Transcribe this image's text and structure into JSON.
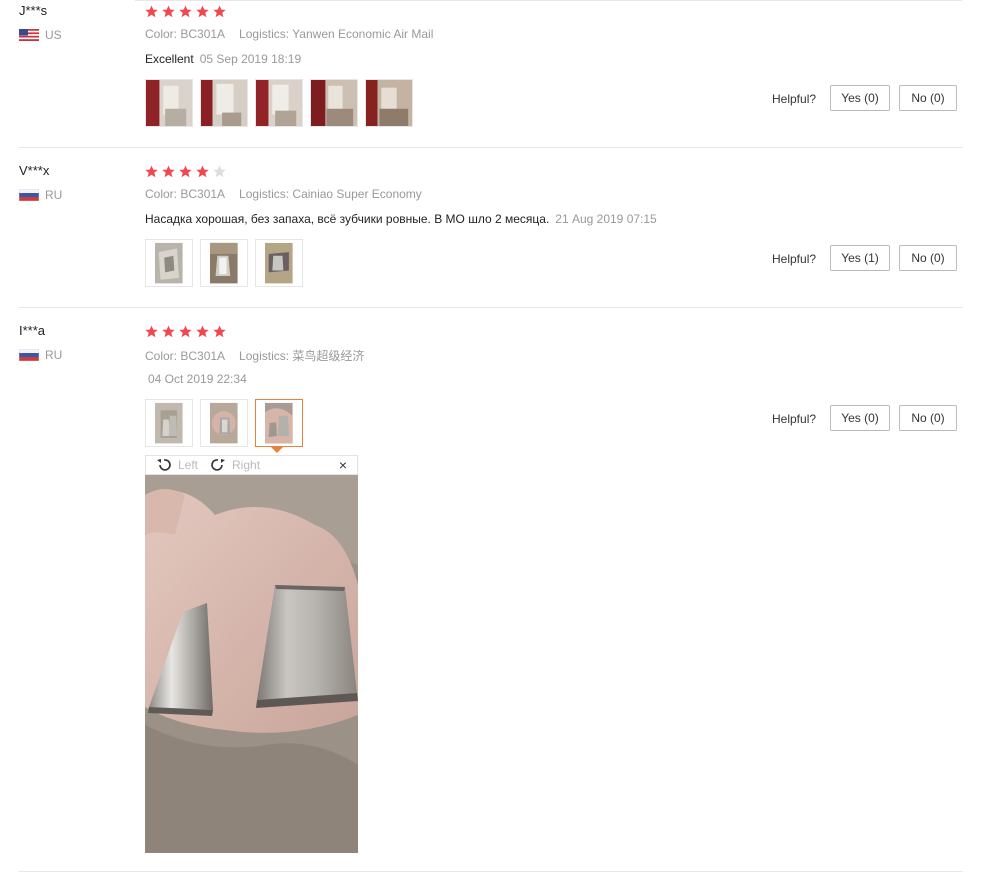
{
  "reviews": [
    {
      "user": "J***s",
      "country": "US",
      "flag": "us-flag",
      "rating": 5,
      "color_label": "Color: BC301A",
      "logistics_label": "Logistics: Yanwen Economic Air Mail",
      "text": "Excellent",
      "date": "05 Sep 2019 18:19",
      "photo_count": 5,
      "helpful_label": "Helpful?",
      "yes_label": "Yes (0)",
      "no_label": "No (0)"
    },
    {
      "user": "V***x",
      "country": "RU",
      "flag": "ru-flag",
      "rating": 4,
      "color_label": "Color: BC301A",
      "logistics_label": "Logistics: Cainiao Super Economy",
      "text": "Насадка хорошая, без запаха, всё зубчики ровные. В МО шло 2 месяца.",
      "date": "21 Aug 2019 07:15",
      "photo_count": 3,
      "helpful_label": "Helpful?",
      "yes_label": "Yes (1)",
      "no_label": "No (0)"
    },
    {
      "user": "I***a",
      "country": "RU",
      "flag": "ru-flag",
      "rating": 5,
      "color_label": "Color: BC301A",
      "logistics_label": "Logistics: 菜鸟超级经济",
      "text": "",
      "date": "04 Oct 2019 22:34",
      "photo_count": 3,
      "selected_photo": 3,
      "helpful_label": "Helpful?",
      "yes_label": "Yes (0)",
      "no_label": "No (0)"
    }
  ],
  "viewer": {
    "rotate_left_label": "Left",
    "rotate_right_label": "Right",
    "close_glyph": "×"
  },
  "colors": {
    "star_on": "#f0484e",
    "star_off": "#dddddd",
    "selected_border": "#e8823a",
    "meta_text": "#999999"
  },
  "icons": [
    "star-icon",
    "us-flag-icon",
    "ru-flag-icon",
    "rotate-left-icon",
    "rotate-right-icon",
    "close-icon"
  ]
}
